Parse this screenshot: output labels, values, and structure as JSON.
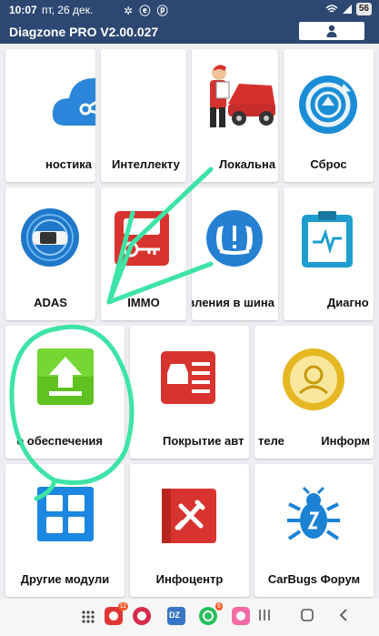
{
  "status_bar": {
    "time": "10:07",
    "date": "пт, 26 дек.",
    "battery": "56"
  },
  "header": {
    "title": "Diagzone PRO V2.00.027"
  },
  "tiles": [
    {
      "label": "ностика"
    },
    {
      "label": "Интеллекту"
    },
    {
      "label": "Локальна"
    },
    {
      "label": "Сброс"
    },
    {
      "label": "ADAS"
    },
    {
      "label": "IMMO"
    },
    {
      "label": "вления в шина"
    },
    {
      "label": "Диагно"
    },
    {
      "label": "о обеспечения"
    },
    {
      "label": "Покрытие авт"
    },
    {
      "label": "теле"
    },
    {
      "label": "Информ"
    },
    {
      "label": "Другие модули"
    },
    {
      "label": "Инфоцентр"
    },
    {
      "label": "CarBugs Форум"
    }
  ],
  "nav": {
    "badges": [
      "11",
      "6"
    ],
    "dz_label": "DZ"
  },
  "colors": {
    "header_bg": "#2c4771",
    "annotation": "#3de4a5"
  }
}
